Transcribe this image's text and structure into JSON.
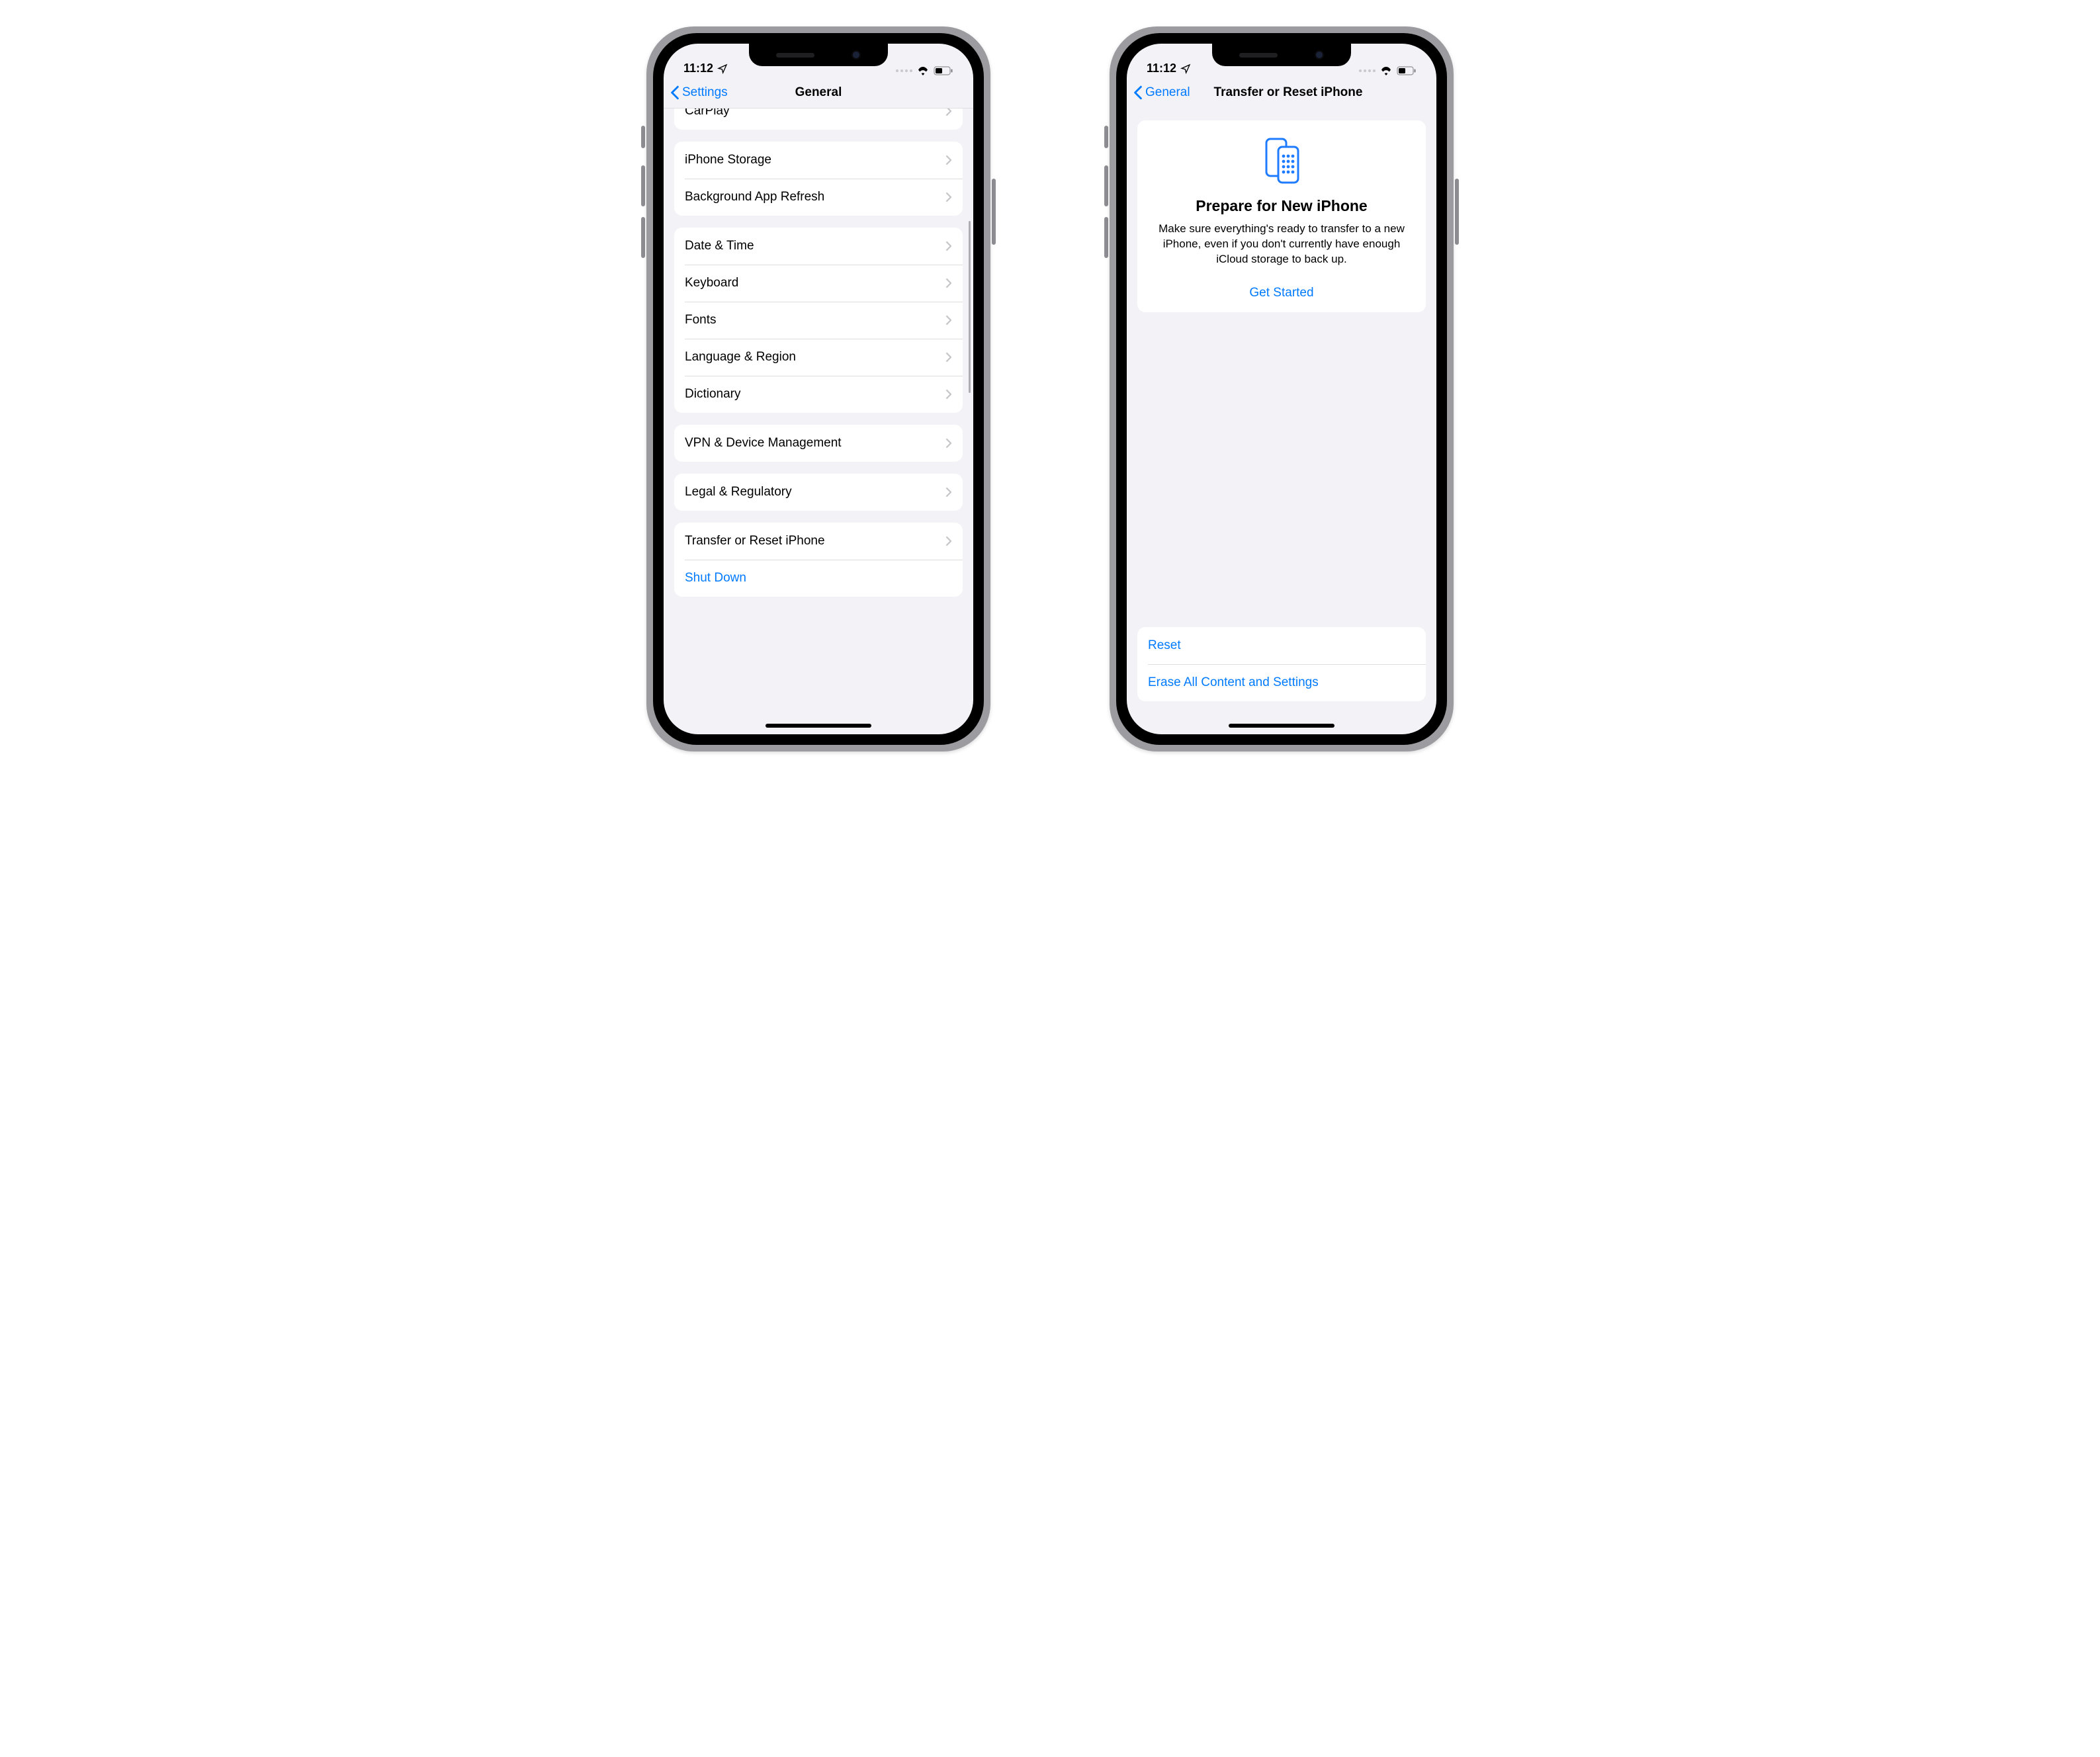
{
  "status": {
    "time": "11:12"
  },
  "phone1": {
    "nav": {
      "back": "Settings",
      "title": "General"
    },
    "group0": [
      {
        "label": "CarPlay"
      }
    ],
    "group1": [
      {
        "label": "iPhone Storage"
      },
      {
        "label": "Background App Refresh"
      }
    ],
    "group2": [
      {
        "label": "Date & Time"
      },
      {
        "label": "Keyboard"
      },
      {
        "label": "Fonts"
      },
      {
        "label": "Language & Region"
      },
      {
        "label": "Dictionary"
      }
    ],
    "group3": [
      {
        "label": "VPN & Device Management"
      }
    ],
    "group4": [
      {
        "label": "Legal & Regulatory"
      }
    ],
    "group5": [
      {
        "label": "Transfer or Reset iPhone",
        "chevron": true
      },
      {
        "label": "Shut Down",
        "action": true
      }
    ]
  },
  "phone2": {
    "nav": {
      "back": "General",
      "title": "Transfer or Reset iPhone"
    },
    "card": {
      "heading": "Prepare for New iPhone",
      "body": "Make sure everything's ready to transfer to a new iPhone, even if you don't currently have enough iCloud storage to back up.",
      "cta": "Get Started"
    },
    "bottom": [
      {
        "label": "Reset"
      },
      {
        "label": "Erase All Content and Settings"
      }
    ]
  }
}
